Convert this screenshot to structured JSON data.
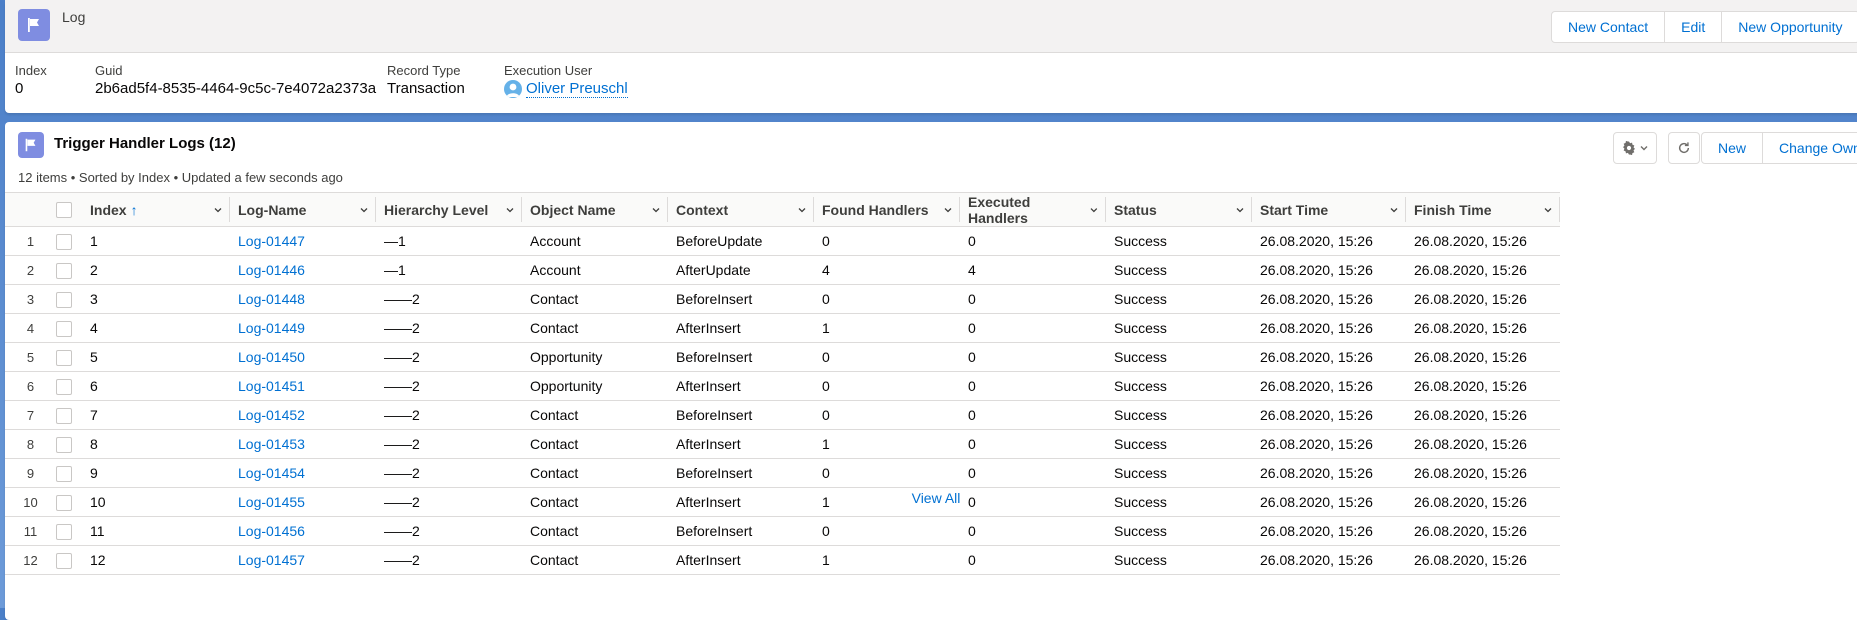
{
  "header": {
    "object_label": "Log",
    "actions": [
      "New Contact",
      "Edit",
      "New Opportunity"
    ],
    "fields": [
      {
        "label": "Index",
        "value": "0"
      },
      {
        "label": "Guid",
        "value": "2b6ad5f4-8535-4464-9c5c-7e4072a2373a"
      },
      {
        "label": "Record Type",
        "value": "Transaction"
      },
      {
        "label": "Execution User",
        "value": "Oliver Preuschl"
      }
    ]
  },
  "related_list": {
    "title": "Trigger Handler Logs (12)",
    "meta": "12 items • Sorted by Index • Updated a few seconds ago",
    "actions": [
      "New",
      "Change Own"
    ],
    "columns": [
      "Index",
      "Log-Name",
      "Hierarchy Level",
      "Object Name",
      "Context",
      "Found Handlers",
      "Executed Handlers",
      "Status",
      "Start Time",
      "Finish Time"
    ],
    "rows": [
      {
        "n": "1",
        "index": "1",
        "name": "Log-01447",
        "level": "—1",
        "object": "Account",
        "context": "BeforeUpdate",
        "found": "0",
        "executed": "0",
        "status": "Success",
        "start": "26.08.2020, 15:26",
        "finish": "26.08.2020, 15:26"
      },
      {
        "n": "2",
        "index": "2",
        "name": "Log-01446",
        "level": "—1",
        "object": "Account",
        "context": "AfterUpdate",
        "found": "4",
        "executed": "4",
        "status": "Success",
        "start": "26.08.2020, 15:26",
        "finish": "26.08.2020, 15:26"
      },
      {
        "n": "3",
        "index": "3",
        "name": "Log-01448",
        "level": "——2",
        "object": "Contact",
        "context": "BeforeInsert",
        "found": "0",
        "executed": "0",
        "status": "Success",
        "start": "26.08.2020, 15:26",
        "finish": "26.08.2020, 15:26"
      },
      {
        "n": "4",
        "index": "4",
        "name": "Log-01449",
        "level": "——2",
        "object": "Contact",
        "context": "AfterInsert",
        "found": "1",
        "executed": "0",
        "status": "Success",
        "start": "26.08.2020, 15:26",
        "finish": "26.08.2020, 15:26"
      },
      {
        "n": "5",
        "index": "5",
        "name": "Log-01450",
        "level": "——2",
        "object": "Opportunity",
        "context": "BeforeInsert",
        "found": "0",
        "executed": "0",
        "status": "Success",
        "start": "26.08.2020, 15:26",
        "finish": "26.08.2020, 15:26"
      },
      {
        "n": "6",
        "index": "6",
        "name": "Log-01451",
        "level": "——2",
        "object": "Opportunity",
        "context": "AfterInsert",
        "found": "0",
        "executed": "0",
        "status": "Success",
        "start": "26.08.2020, 15:26",
        "finish": "26.08.2020, 15:26"
      },
      {
        "n": "7",
        "index": "7",
        "name": "Log-01452",
        "level": "——2",
        "object": "Contact",
        "context": "BeforeInsert",
        "found": "0",
        "executed": "0",
        "status": "Success",
        "start": "26.08.2020, 15:26",
        "finish": "26.08.2020, 15:26"
      },
      {
        "n": "8",
        "index": "8",
        "name": "Log-01453",
        "level": "——2",
        "object": "Contact",
        "context": "AfterInsert",
        "found": "1",
        "executed": "0",
        "status": "Success",
        "start": "26.08.2020, 15:26",
        "finish": "26.08.2020, 15:26"
      },
      {
        "n": "9",
        "index": "9",
        "name": "Log-01454",
        "level": "——2",
        "object": "Contact",
        "context": "BeforeInsert",
        "found": "0",
        "executed": "0",
        "status": "Success",
        "start": "26.08.2020, 15:26",
        "finish": "26.08.2020, 15:26"
      },
      {
        "n": "10",
        "index": "10",
        "name": "Log-01455",
        "level": "——2",
        "object": "Contact",
        "context": "AfterInsert",
        "found": "1",
        "executed": "0",
        "status": "Success",
        "start": "26.08.2020, 15:26",
        "finish": "26.08.2020, 15:26"
      },
      {
        "n": "11",
        "index": "11",
        "name": "Log-01456",
        "level": "——2",
        "object": "Contact",
        "context": "BeforeInsert",
        "found": "0",
        "executed": "0",
        "status": "Success",
        "start": "26.08.2020, 15:26",
        "finish": "26.08.2020, 15:26"
      },
      {
        "n": "12",
        "index": "12",
        "name": "Log-01457",
        "level": "——2",
        "object": "Contact",
        "context": "AfterInsert",
        "found": "1",
        "executed": "0",
        "status": "Success",
        "start": "26.08.2020, 15:26",
        "finish": "26.08.2020, 15:26"
      }
    ],
    "view_all": "View All"
  },
  "icons": {
    "object": "flag-icon",
    "settings": "gear-icon",
    "refresh": "refresh-icon",
    "sort": "arrow-up-icon",
    "column_menu": "chevron-down-icon",
    "user": "user-avatar-icon"
  },
  "colors": {
    "link": "#0070d2",
    "object_icon": "#7f8de1",
    "background": "#5c8fd3"
  }
}
